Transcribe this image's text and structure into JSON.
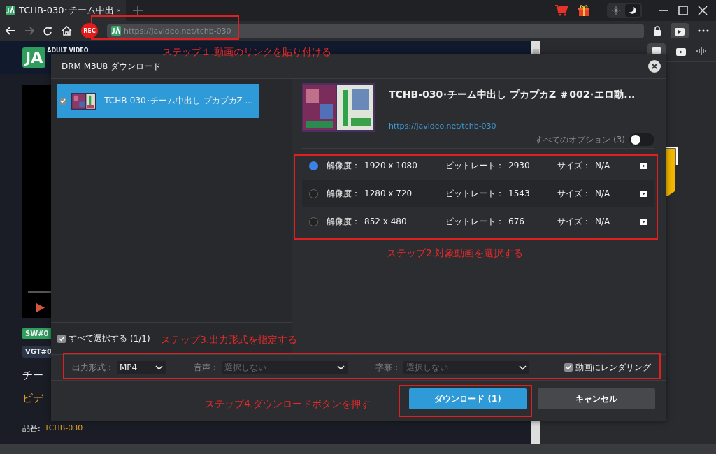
{
  "browser": {
    "tab": {
      "title": "TCHB-030･チーム中出",
      "selected": true
    },
    "rec": "REC",
    "url": "https://javideo.net/tchb-030",
    "dark_theme": true
  },
  "page": {
    "logo": {
      "mark": "JA",
      "caption": "ADULT VIDEO"
    },
    "tags": [
      {
        "label": "SW#0",
        "color": "#2f9e5c"
      },
      {
        "label": "VGT#0",
        "color": "#2c3548"
      }
    ],
    "title": "チー",
    "category": "ビデ",
    "product": {
      "label": "品番:",
      "value": "TCHB-030"
    }
  },
  "dialog": {
    "title": "DRM M3U8 ダウンロード",
    "items": [
      {
        "title": "TCHB-030･チーム中出し プカプカZ ...",
        "checked": true,
        "selected": true
      }
    ],
    "details": {
      "title": "TCHB-030･チーム中出し プカプカZ ＃002･エロ動...",
      "url": "https://javideo.net/tchb-030",
      "options_label": "すべてのオプション",
      "options_count": "(3)",
      "all_options": false
    },
    "streams": [
      {
        "resolution_label": "解像度：",
        "resolution": "1920 x 1080",
        "bitrate_label": "ビットレート：",
        "bitrate": "2930",
        "size_label": "サイズ：",
        "size": "N/A",
        "selected": true
      },
      {
        "resolution_label": "解像度：",
        "resolution": "1280 x 720",
        "bitrate_label": "ビットレート：",
        "bitrate": "1543",
        "size_label": "サイズ：",
        "size": "N/A",
        "selected": false
      },
      {
        "resolution_label": "解像度：",
        "resolution": "852 x 480",
        "bitrate_label": "ビットレート：",
        "bitrate": "676",
        "size_label": "サイズ：",
        "size": "N/A",
        "selected": false
      }
    ],
    "select_all": {
      "label": "すべて選択する",
      "count": "(1/1)",
      "checked": true
    },
    "output": {
      "format_label": "出力形式：",
      "format": "MP4",
      "audio_label": "音声：",
      "audio_placeholder": "選択しない",
      "subtitle_label": "字幕：",
      "subtitle_placeholder": "選択しない",
      "render_label": "動画にレンダリング",
      "render_checked": true
    },
    "buttons": {
      "download": "ダウンロード (1)",
      "cancel": "キャンセル"
    }
  },
  "annotations": [
    {
      "text": "ステップ１.動画のリンクを貼り付ける"
    },
    {
      "text": "ステップ2.対象動画を選択する"
    },
    {
      "text": "ステップ3.出力形式を指定する"
    },
    {
      "text": "ステップ4.ダウンロードボタンを押す"
    }
  ]
}
